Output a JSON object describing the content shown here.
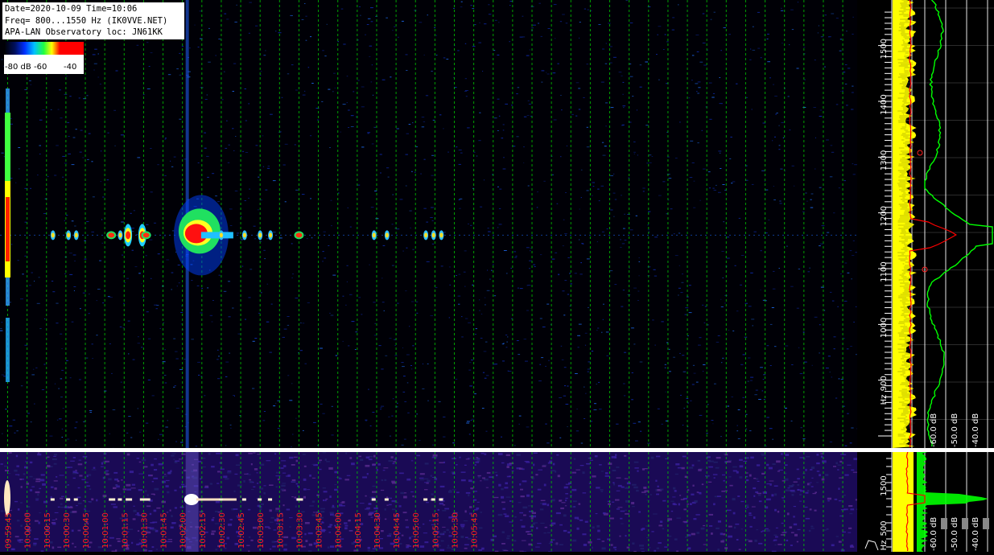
{
  "info": {
    "line1": "Date=2020-10-09 Time=10:06",
    "line2": "Freq= 800...1550 Hz (IK0VVE.NET)",
    "line3": "APA-LAN Observatory loc: JN61KK"
  },
  "colorbar": {
    "label_a": "-80 dB",
    "label_b": "-60",
    "label_c": "-40"
  },
  "chart_data": {
    "type": "heatmap",
    "title": "",
    "ylabel": "Hz",
    "freq_range_hz": [
      800,
      1550
    ],
    "freq_ticks": [
      "1500",
      "1400",
      "1300",
      "1200",
      "1100",
      "1000",
      "900"
    ],
    "freq_unit": "Hz",
    "zoom_freq_ticks": [
      "1500",
      "500"
    ],
    "zoom_freq_unit": "Hz",
    "time_ticks": [
      "09:59:45",
      "10:00:00",
      "10:00:15",
      "10:00:30",
      "10:00:45",
      "10:01:00",
      "10:01:15",
      "10:01:30",
      "10:01:45",
      "10:02:00",
      "10:02:15",
      "10:02:30",
      "10:02:45",
      "10:03:00",
      "10:03:15",
      "10:03:30",
      "10:03:45",
      "10:04:00",
      "10:04:15",
      "10:04:30",
      "10:04:45",
      "10:05:00",
      "10:05:15",
      "10:05:30",
      "10:05:45"
    ],
    "carrier_freq_hz": 1160,
    "db_scale": [
      "-80 dB",
      "-60",
      "-40"
    ],
    "spectrum_db_labels": [
      "-60.0 dB",
      "-50.0 dB",
      "-40.0 dB"
    ],
    "zoom_spectrum_db_labels": [
      "-60.0 dB",
      "-50.0 dB",
      "-40.0 dB"
    ],
    "echo_times": [
      "09:59:45",
      "10:00:20",
      "10:00:32",
      "10:00:38",
      "10:01:05",
      "10:01:12",
      "10:01:18",
      "10:01:29",
      "10:01:32",
      "10:02:02",
      "10:02:30",
      "10:02:48",
      "10:03:00",
      "10:03:08",
      "10:03:30",
      "10:04:28",
      "10:04:38",
      "10:05:08",
      "10:05:14",
      "10:05:20"
    ],
    "colors": {
      "grid": "#00c800",
      "time_labels": "#ff2020",
      "spectrum_mean": "#00ff00",
      "spectrum_peak": "#ffff00",
      "spectrum_current": "#ff0000"
    }
  }
}
